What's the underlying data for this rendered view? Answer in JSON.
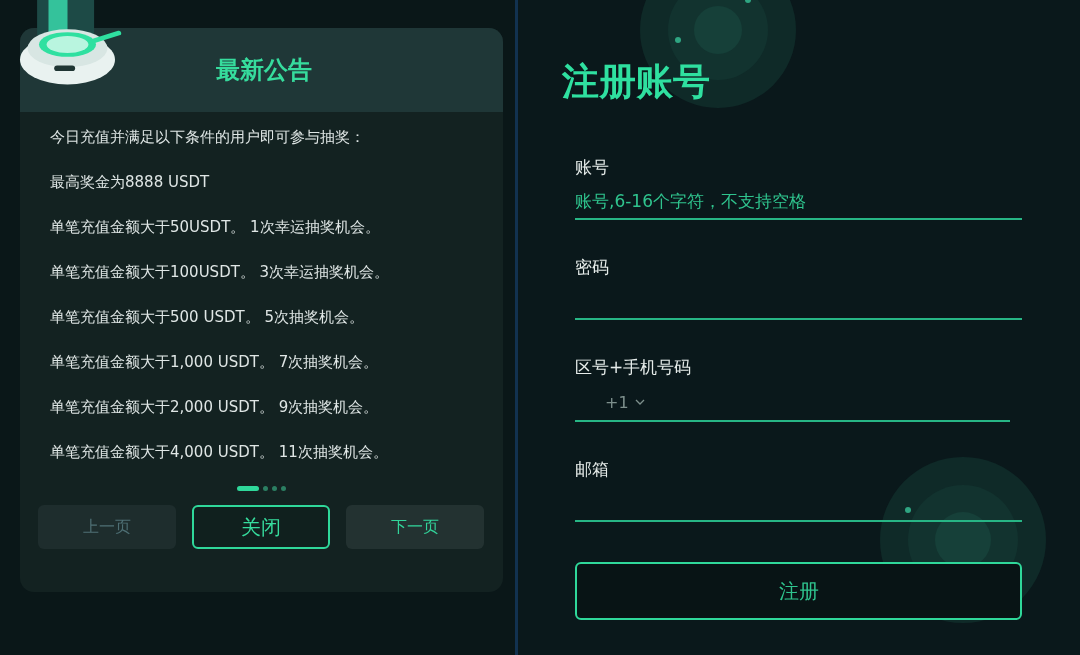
{
  "announcement": {
    "title": "最新公告",
    "lines": [
      "今日充值并满足以下条件的用户即可参与抽奖：",
      "最高奖金为8888 USDT",
      "单笔充值金额大于50USDT。 1次幸运抽奖机会。",
      "单笔充值金额大于100USDT。 3次幸运抽奖机会。",
      "单笔充值金额大于500 USDT。 5次抽奖机会。",
      "单笔充值金额大于1,000 USDT。 7次抽奖机会。",
      "单笔充值金额大于2,000 USDT。 9次抽奖机会。",
      "单笔充值金额大于4,000 USDT。 11次抽奖机会。"
    ],
    "pages": [
      {
        "selected": true
      },
      {
        "selected": false
      },
      {
        "selected": false
      },
      {
        "selected": false
      }
    ],
    "buttons": [
      {
        "kind": "prev",
        "label": "上一页",
        "disabled": true
      },
      {
        "kind": "close",
        "label": "关闭",
        "disabled": false
      },
      {
        "kind": "next",
        "label": "下一页",
        "disabled": false
      }
    ]
  },
  "register": {
    "title": "注册账号",
    "fields": [
      {
        "kind": "text",
        "label": "账号",
        "placeholder": "账号,6-16个字符，不支持空格"
      },
      {
        "kind": "password",
        "label": "密码"
      },
      {
        "kind": "phone",
        "label": "区号+手机号码",
        "country_code": "+1"
      },
      {
        "kind": "email",
        "label": "邮箱"
      }
    ],
    "submit": "注册"
  }
}
